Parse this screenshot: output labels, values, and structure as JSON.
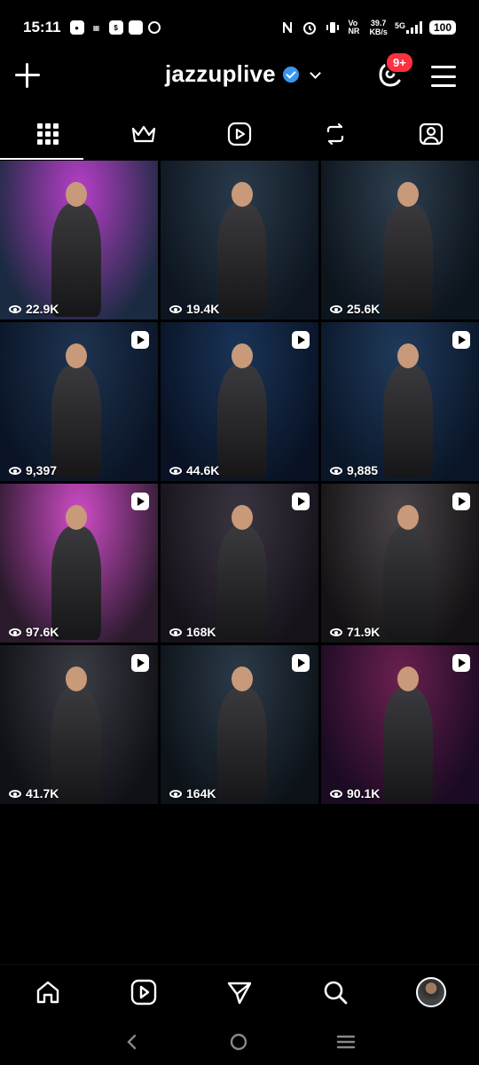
{
  "status_bar": {
    "time": "15:11",
    "left_icons": [
      "line-icon",
      "gsm-icon",
      "shopping-bag-icon",
      "square-icon",
      "threads-icon"
    ],
    "carrier_tag": "Vo NR",
    "net_speed_value": "39.7",
    "net_speed_unit": "KB/s",
    "network": "5G",
    "battery": "100"
  },
  "header": {
    "username": "jazzuplive",
    "notification_badge": "9+"
  },
  "tabs": [
    {
      "name": "tab-posts",
      "icon": "grid-icon",
      "active": true
    },
    {
      "name": "tab-featured",
      "icon": "crown-icon",
      "active": false
    },
    {
      "name": "tab-reels",
      "icon": "reels-icon",
      "active": false
    },
    {
      "name": "tab-reposts",
      "icon": "repost-icon",
      "active": false
    },
    {
      "name": "tab-tagged",
      "icon": "tagged-person-icon",
      "active": false
    }
  ],
  "posts": [
    {
      "views": "22.9K",
      "reel": false,
      "bg": [
        "#b83ec9",
        "#1a2a40"
      ]
    },
    {
      "views": "19.4K",
      "reel": false,
      "bg": [
        "#2a3a4a",
        "#0d1620"
      ]
    },
    {
      "views": "25.6K",
      "reel": false,
      "bg": [
        "#2e3e4e",
        "#0c141c"
      ]
    },
    {
      "views": "9,397",
      "reel": true,
      "bg": [
        "#1e3450",
        "#0a1426"
      ]
    },
    {
      "views": "44.6K",
      "reel": true,
      "bg": [
        "#1a3458",
        "#081224"
      ]
    },
    {
      "views": "9,885",
      "reel": true,
      "bg": [
        "#203a5c",
        "#0a1628"
      ]
    },
    {
      "views": "97.6K",
      "reel": true,
      "bg": [
        "#d04cc8",
        "#2a1a2c"
      ]
    },
    {
      "views": "168K",
      "reel": true,
      "bg": [
        "#3a3440",
        "#16121a"
      ]
    },
    {
      "views": "71.9K",
      "reel": true,
      "bg": [
        "#4a4448",
        "#141214"
      ]
    },
    {
      "views": "41.7K",
      "reel": true,
      "bg": [
        "#3a3c44",
        "#101116"
      ]
    },
    {
      "views": "164K",
      "reel": true,
      "bg": [
        "#2c3a48",
        "#0c1218"
      ]
    },
    {
      "views": "90.1K",
      "reel": true,
      "bg": [
        "#6a2050",
        "#1a0a22"
      ]
    }
  ],
  "bottom_nav": [
    "home-icon",
    "reels-icon",
    "send-icon",
    "search-icon",
    "profile-avatar"
  ],
  "system_nav": [
    "back-icon",
    "home-circle-icon",
    "recents-icon"
  ]
}
